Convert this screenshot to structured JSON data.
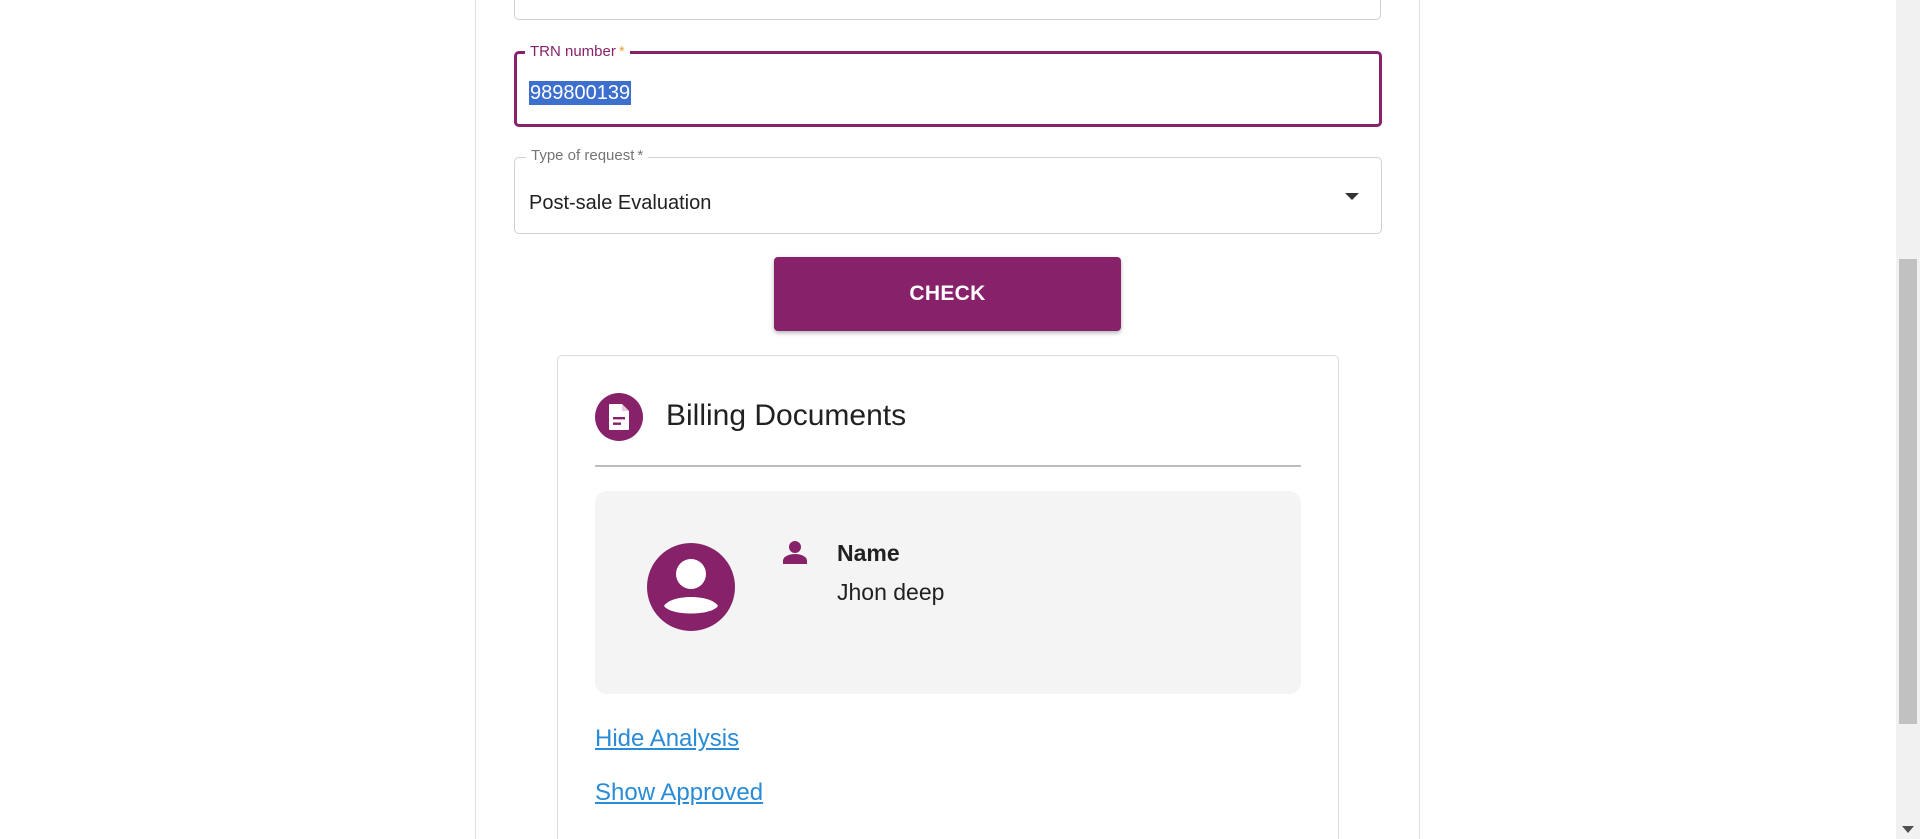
{
  "form": {
    "trn": {
      "label": "TRN number",
      "required_marker": "*",
      "value": "989800139"
    },
    "request_type": {
      "label": "Type of request",
      "required_marker": "*",
      "selected": "Post-sale Evaluation"
    },
    "check_button": "CHECK"
  },
  "billing_card": {
    "title": "Billing Documents",
    "header_icon": "document-icon",
    "person": {
      "avatar_icon": "account-circle-icon",
      "field_icon": "person-icon",
      "name_label": "Name",
      "name_value": "Jhon deep"
    },
    "links": {
      "hide_analysis": "Hide Analysis",
      "show_approved": "Show Approved"
    }
  },
  "colors": {
    "brand": "#87226a",
    "link": "#2a8bd6",
    "selection": "#3d6fce"
  }
}
